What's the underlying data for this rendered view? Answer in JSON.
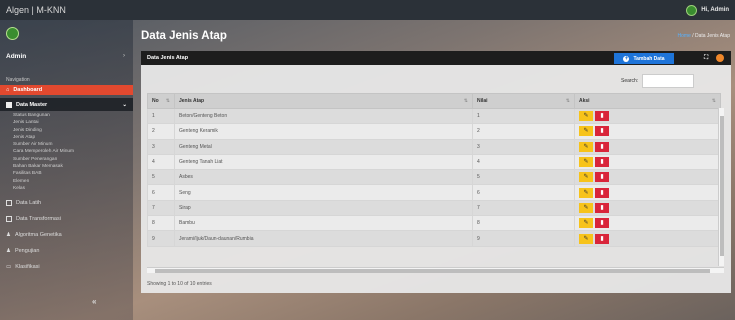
{
  "topbar": {
    "brand": "Algen | M-KNN",
    "greeting": "Hi, Admin"
  },
  "sidebar": {
    "user": "Admin",
    "nav_title": "Navigation",
    "dashboard": "Dashboard",
    "data_master": "Data Master",
    "sub_items": [
      "Status Bangunan",
      "Jenis Lantai",
      "Jenis Dinding",
      "Jenis Atap",
      "Sumber Air Minum",
      "Cara Memperoleh Air Minum",
      "Sumber Penerangan",
      "Bahan Bakar Memasak",
      "Fasilitas BAB",
      "Elemen",
      "Kelas"
    ],
    "lower_items": [
      "Data Latih",
      "Data Transformasi",
      "Algoritma Genetika",
      "Pengujian",
      "Klasifikasi"
    ],
    "collapse": "«"
  },
  "page": {
    "title": "Data Jenis Atap",
    "breadcrumb_home": "Home",
    "breadcrumb_sep": "/",
    "breadcrumb_current": "Data Jenis Atap"
  },
  "card": {
    "title": "Data Jenis Atap",
    "add_button": "Tambah Data",
    "search_label": "Search:",
    "info": "Showing 1 to 10 of 10 entries"
  },
  "table": {
    "headers": [
      "No",
      "Jenis Atap",
      "Nilai",
      "Aksi"
    ],
    "rows": [
      [
        "1",
        "Beton/Genteng Beton",
        "1"
      ],
      [
        "2",
        "Genteng Keramik",
        "2"
      ],
      [
        "3",
        "Genteng Metal",
        "3"
      ],
      [
        "4",
        "Genteng Tanah Liat",
        "4"
      ],
      [
        "5",
        "Asbes",
        "5"
      ],
      [
        "6",
        "Seng",
        "6"
      ],
      [
        "7",
        "Sirap",
        "7"
      ],
      [
        "8",
        "Bambu",
        "8"
      ],
      [
        "9",
        "Jerami/Ijuk/Daun-daunan/Rumbia",
        "9"
      ]
    ]
  },
  "colors": {
    "active": "#e2492f",
    "add": "#1e74d9",
    "edit": "#f7c31a",
    "delete": "#d9253a"
  }
}
